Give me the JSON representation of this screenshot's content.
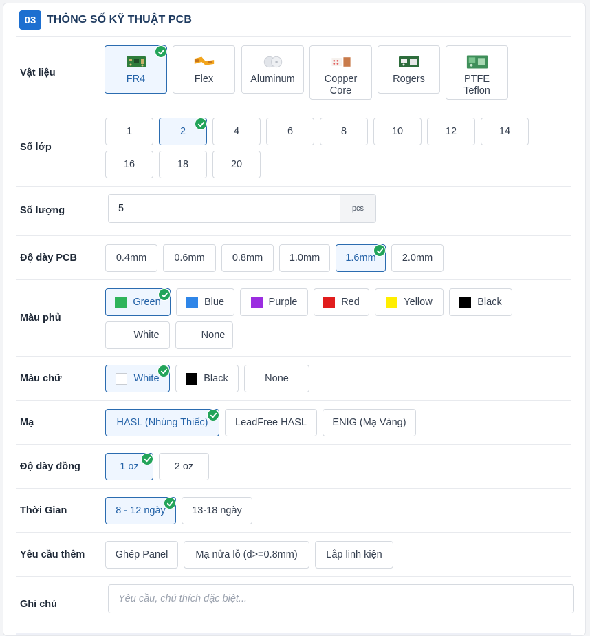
{
  "section": {
    "number": "03",
    "title": "THÔNG SỐ KỸ THUẬT PCB"
  },
  "material": {
    "label": "Vật liệu",
    "options": [
      {
        "name": "FR4",
        "selected": true,
        "icon": "fr4-board-icon"
      },
      {
        "name": "Flex",
        "selected": false,
        "icon": "flex-pcb-icon"
      },
      {
        "name": "Aluminum",
        "selected": false,
        "icon": "aluminum-pcb-icon"
      },
      {
        "name": "Copper\nCore",
        "selected": false,
        "icon": "copper-core-icon"
      },
      {
        "name": "Rogers",
        "selected": false,
        "icon": "rogers-board-icon"
      },
      {
        "name": "PTFE\nTeflon",
        "selected": false,
        "icon": "ptfe-teflon-icon"
      }
    ]
  },
  "layers": {
    "label": "Số lớp",
    "options": [
      "1",
      "2",
      "4",
      "6",
      "8",
      "10",
      "12",
      "14",
      "16",
      "18",
      "20"
    ],
    "selected": "2"
  },
  "quantity": {
    "label": "Số lượng",
    "value": "5",
    "unit": "pcs"
  },
  "thickness": {
    "label": "Độ dày PCB",
    "options": [
      "0.4mm",
      "0.6mm",
      "0.8mm",
      "1.0mm",
      "1.6mm",
      "2.0mm"
    ],
    "selected": "1.6mm"
  },
  "solder_mask": {
    "label": "Màu phủ",
    "options": [
      {
        "name": "Green",
        "color": "#2fb45b"
      },
      {
        "name": "Blue",
        "color": "#2f86e8"
      },
      {
        "name": "Purple",
        "color": "#9b2de0"
      },
      {
        "name": "Red",
        "color": "#e11d1d"
      },
      {
        "name": "Yellow",
        "color": "#ffee00"
      },
      {
        "name": "Black",
        "color": "#000000"
      },
      {
        "name": "White",
        "color": "#ffffff"
      },
      {
        "name": "None",
        "color": null
      }
    ],
    "selected": "Green"
  },
  "silkscreen": {
    "label": "Màu chữ",
    "options": [
      {
        "name": "White",
        "color": "#ffffff"
      },
      {
        "name": "Black",
        "color": "#000000"
      },
      {
        "name": "None",
        "color": null
      }
    ],
    "selected": "White"
  },
  "finish": {
    "label": "Mạ",
    "options": [
      "HASL (Nhúng Thiếc)",
      "LeadFree HASL",
      "ENIG (Mạ Vàng)"
    ],
    "selected": "HASL (Nhúng Thiếc)"
  },
  "copper": {
    "label": "Độ dày đồng",
    "options": [
      "1 oz",
      "2 oz"
    ],
    "selected": "1 oz"
  },
  "lead_time": {
    "label": "Thời Gian",
    "options": [
      "8 - 12 ngày",
      "13-18 ngày"
    ],
    "selected": "8 - 12 ngày"
  },
  "extras": {
    "label": "Yêu cầu thêm",
    "options": [
      "Ghép Panel",
      "Mạ nửa lỗ (d>=0.8mm)",
      "Lắp linh kiện"
    ]
  },
  "note": {
    "label": "Ghi chú",
    "placeholder": "Yêu cầu, chú thích đặc biệt..."
  },
  "colors": {
    "accent": "#1d6fd0",
    "check": "#23a45a",
    "title": "#1e3a5f"
  }
}
